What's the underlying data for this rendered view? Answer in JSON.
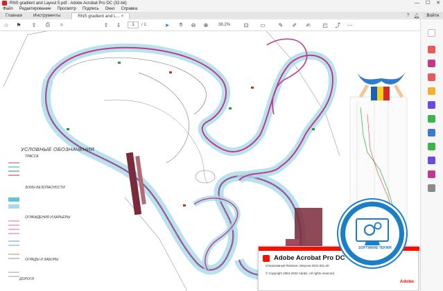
{
  "window": {
    "title": "RNS gradient and Layout 5.pdf - Adobe Acrobat Pro DC (32-bit)",
    "minimize": "—",
    "maximize": "☐",
    "close": "✕"
  },
  "menu": [
    "Файл",
    "Редактирование",
    "Просмотр",
    "Подпись",
    "Окно",
    "Справка"
  ],
  "tabs": {
    "home": "Главная",
    "tools": "Инструменты",
    "document": "RNS gradient and L...",
    "document_close": "×"
  },
  "account": {
    "sign_in": "Войти"
  },
  "toolbar": {
    "page_current": "1",
    "page_total": "/ 1",
    "zoom": "38,2%"
  },
  "legend": {
    "heading": "УСЛОВНЫЕ ОБОЗНАЧЕНИЯ",
    "section_track": "ТРАССА",
    "section_safety": "ЗОНЫ БЕЗОПАСНОСТИ",
    "section_barriers": "ОГРАЖДЕНИЯ И БАРЬЕРЫ",
    "section_fences": "ОГРАДЫ И ЗАБОРЫ",
    "section_roads": "ДОРОГИ"
  },
  "splash": {
    "product": "Adobe Acrobat Pro DC",
    "release": "Оперативный Release | Версия 2022.001.20",
    "copyright": "© Copyright 1984-2022 Adobe. All rights reserved.",
    "brand": "Adobe"
  },
  "watermark": {
    "label": "SOFTWARE TEKNIK"
  },
  "colors": {
    "adobe_red": "#fa0f00",
    "track_magenta": "#c0398e",
    "safety_cyan": "#1fa9c9",
    "badge_blue": "#1a7ec8"
  }
}
